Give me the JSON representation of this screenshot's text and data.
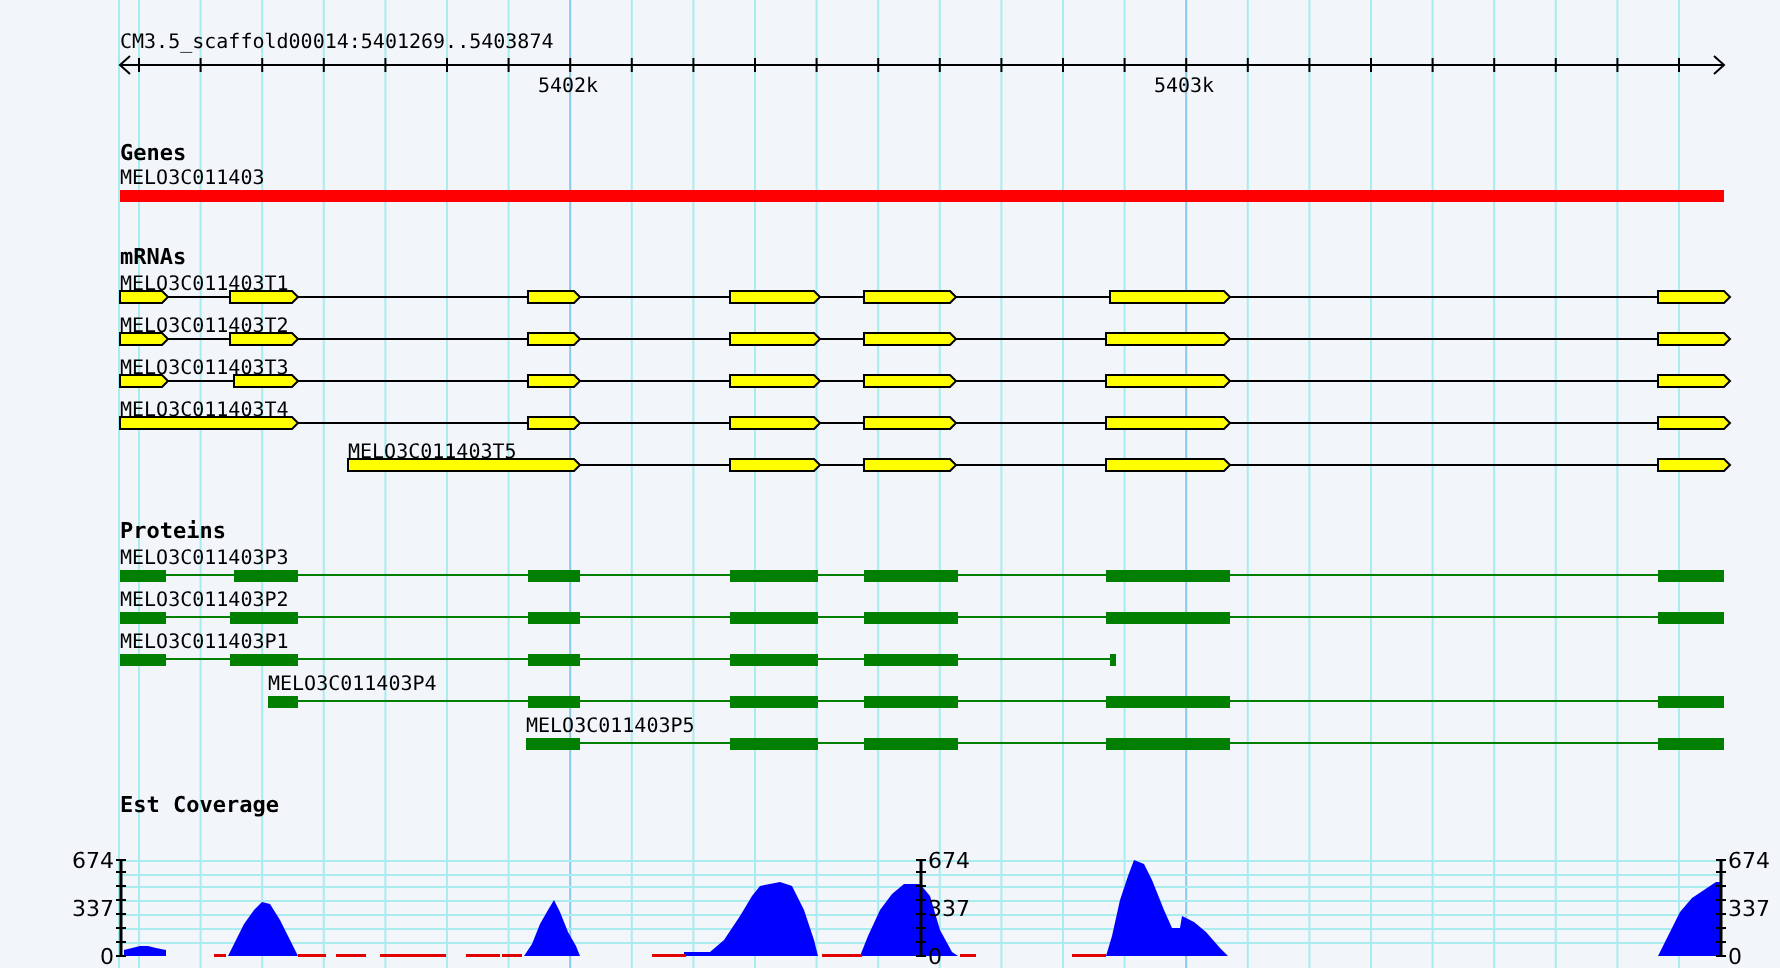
{
  "ruler": {
    "region": "CM3.5_scaffold00014:5401269..5403874",
    "ticks": [
      "5402k",
      "5403k"
    ]
  },
  "tracks": [
    {
      "kind": "gene",
      "title": "Genes",
      "features": [
        "MELO3C011403"
      ]
    },
    {
      "kind": "mrna",
      "title": "mRNAs",
      "features": [
        "MELO3C011403T1",
        "MELO3C011403T2",
        "MELO3C011403T3",
        "MELO3C011403T4",
        "MELO3C011403T5"
      ]
    },
    {
      "kind": "protein",
      "title": "Proteins",
      "features": [
        "MELO3C011403P3",
        "MELO3C011403P2",
        "MELO3C011403P1",
        "MELO3C011403P4",
        "MELO3C011403P5"
      ]
    },
    {
      "kind": "coverage",
      "title": "Est Coverage",
      "scales": [
        {
          "labels": [
            "674",
            "337",
            "0"
          ]
        },
        {
          "labels": [
            "674",
            "337",
            "0"
          ]
        },
        {
          "labels": [
            "674",
            "337",
            "0"
          ]
        }
      ]
    }
  ]
}
